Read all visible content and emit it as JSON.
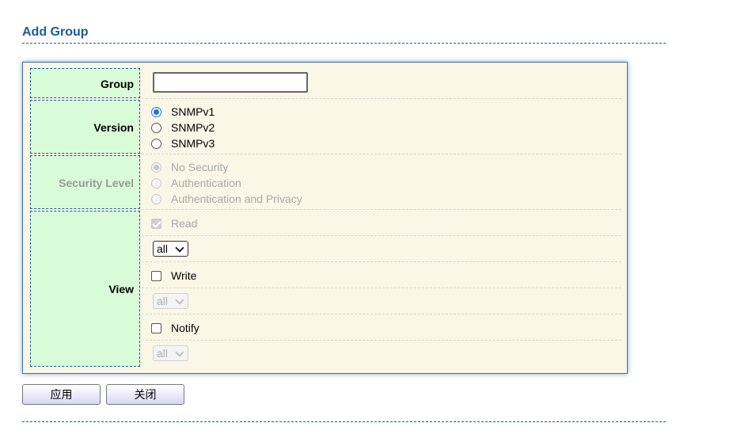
{
  "page": {
    "title": "Add Group"
  },
  "form": {
    "group": {
      "label": "Group",
      "value": ""
    },
    "version": {
      "label": "Version",
      "options": [
        "SNMPv1",
        "SNMPv2",
        "SNMPv3"
      ],
      "selected": "SNMPv1"
    },
    "security_level": {
      "label": "Security Level",
      "options": [
        "No Security",
        "Authentication",
        "Authentication and Privacy"
      ],
      "selected": "No Security",
      "disabled": true
    },
    "view": {
      "label": "View",
      "read": {
        "label": "Read",
        "checked": true,
        "disabled": true,
        "select_value": "all"
      },
      "write": {
        "label": "Write",
        "checked": false,
        "select_value": "all",
        "select_disabled": true
      },
      "notify": {
        "label": "Notify",
        "checked": false,
        "select_value": "all",
        "select_disabled": true
      }
    }
  },
  "buttons": {
    "apply": "应用",
    "close": "关闭"
  },
  "colors": {
    "title": "#1a5aa0",
    "label_bg": "#d8fcd8",
    "form_bg": "#fbf7e6",
    "radio_accent": "#1a73e8"
  }
}
